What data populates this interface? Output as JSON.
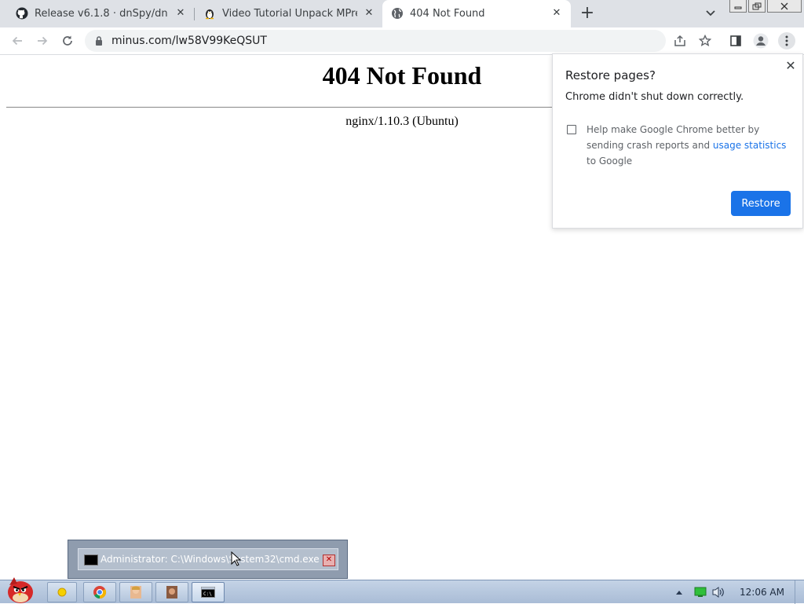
{
  "browser": {
    "tabs": [
      {
        "title": "Release v6.1.8 · dnSpy/dnSpy ·",
        "favicon": "github-icon",
        "active": false
      },
      {
        "title": "Video Tutorial Unpack MPress",
        "favicon": "penguin-icon",
        "active": false
      },
      {
        "title": "404 Not Found",
        "favicon": "globe-icon",
        "active": true
      }
    ],
    "new_tab_label": "+",
    "address": "minus.com/lw58V99KeQSUT"
  },
  "page": {
    "heading": "404 Not Found",
    "server": "nginx/1.10.3 (Ubuntu)"
  },
  "restore_bubble": {
    "title": "Restore pages?",
    "subtitle": "Chrome didn't shut down correctly.",
    "checkbox_text_before": "Help make Google Chrome better by sending crash reports and ",
    "checkbox_link": "usage statistics",
    "checkbox_text_after": " to Google",
    "checkbox_checked": false,
    "button_label": "Restore"
  },
  "taskbar": {
    "thumbnail_title": "Administrator: C:\\Windows\\System32\\cmd.exe",
    "clock": "12:06 AM"
  },
  "colors": {
    "accent": "#1a73e8",
    "tabstrip": "#dee1e6"
  }
}
